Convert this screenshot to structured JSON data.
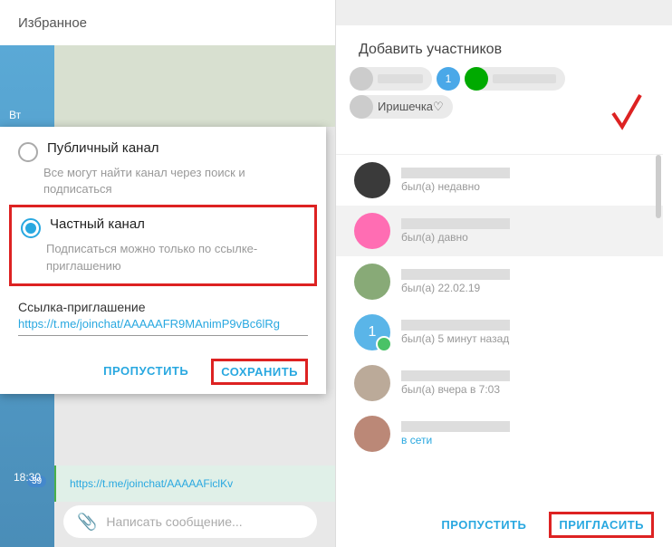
{
  "left": {
    "header_title": "Избранное",
    "bg_day": "Вт",
    "bg_time": "18:30",
    "bg_badge": "39",
    "bg_link_preview": "https://t.me/joinchat/AAAAAFiclKv",
    "input_placeholder": "Написать сообщение...",
    "options": {
      "public": {
        "title": "Публичный канал",
        "sub": "Все могут найти канал через поиск и подписаться"
      },
      "private": {
        "title": "Частный канал",
        "sub": "Подписаться можно только по ссылке-приглашению"
      }
    },
    "invite": {
      "label": "Ссылка-приглашение",
      "url": "https://t.me/joinchat/AAAAAFR9MAnimP9vBc6lRg"
    },
    "actions": {
      "skip": "ПРОПУСТИТЬ",
      "save": "СОХРАНИТЬ"
    }
  },
  "right": {
    "title": "Добавить участников",
    "chips": {
      "num": "1",
      "named": "Иришечка♡"
    },
    "contacts": [
      {
        "status": "был(а) недавно",
        "avatar": "dark"
      },
      {
        "status": "был(а) давно",
        "avatar": "pink",
        "selected": true
      },
      {
        "status": "был(а) 22.02.19",
        "avatar": "photo"
      },
      {
        "status": "был(а) 5 минут назад",
        "avatar": "blue",
        "checked": true,
        "initial": "1"
      },
      {
        "status": "был(а) вчера в 7:03",
        "avatar": "photo2"
      },
      {
        "status": "в сети",
        "avatar": "photo3",
        "online": true
      }
    ],
    "actions": {
      "skip": "ПРОПУСТИТЬ",
      "invite": "ПРИГЛАСИТЬ"
    }
  }
}
